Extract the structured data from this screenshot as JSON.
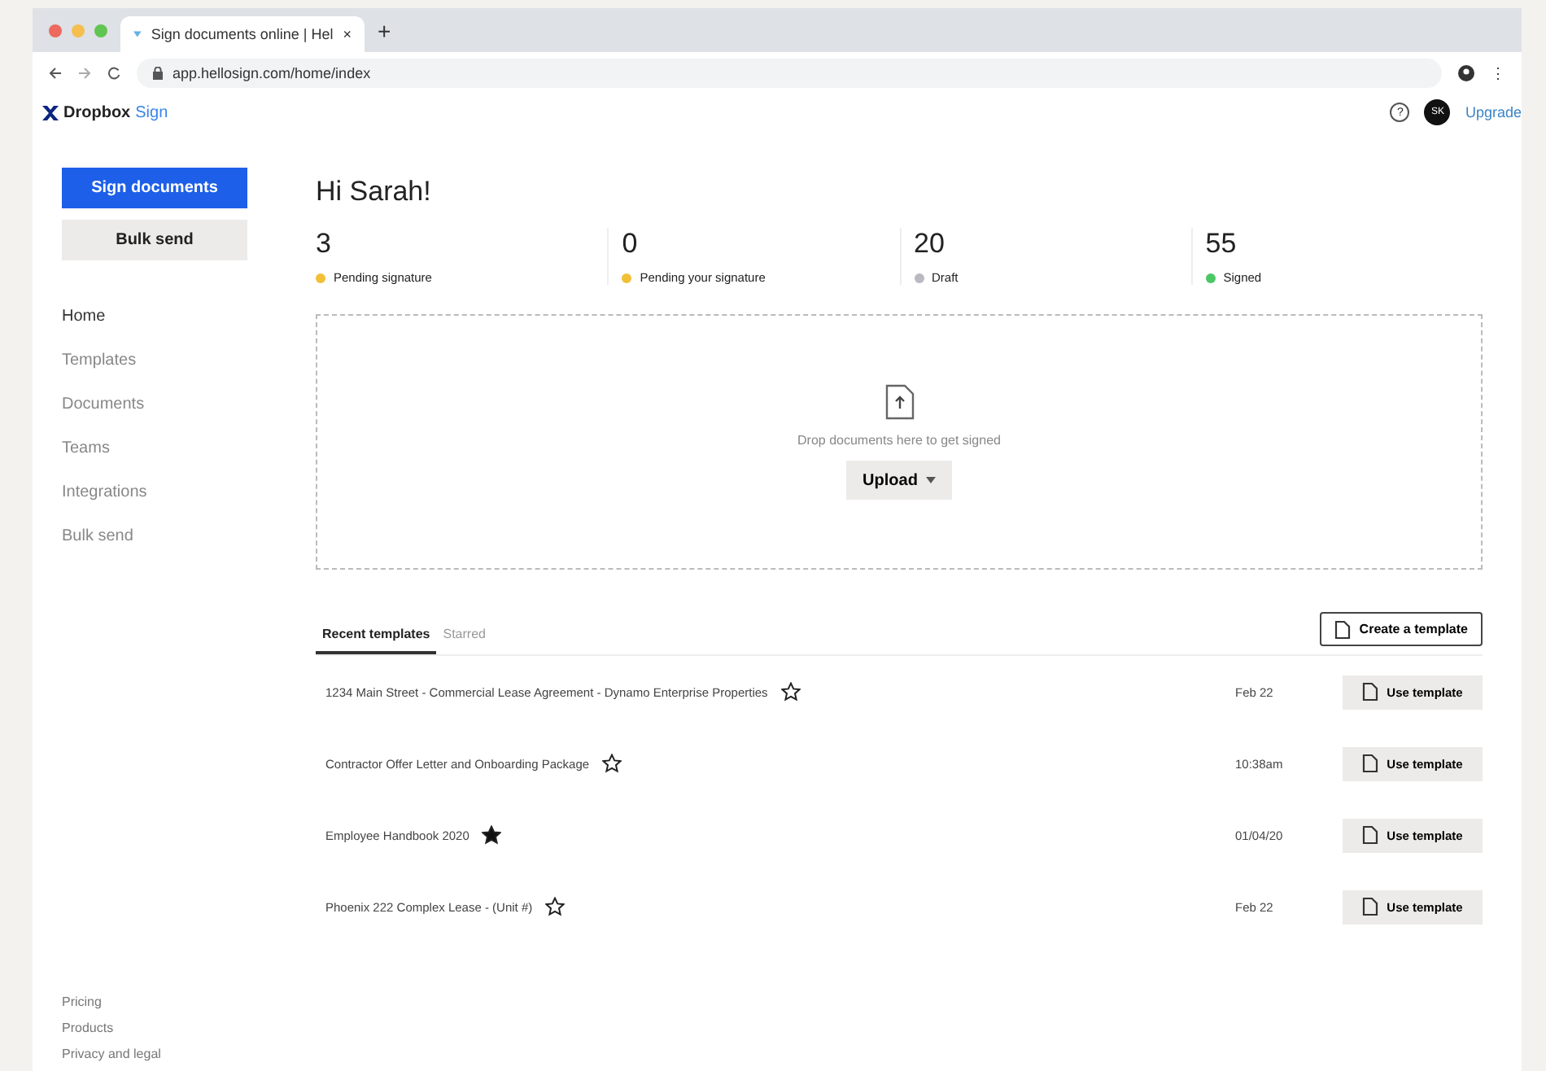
{
  "browser": {
    "tab_title": "Sign documents online | Hel",
    "tab_close": "×",
    "new_tab": "+",
    "url": "app.hellosign.com/home/index",
    "menu": "⋮"
  },
  "header": {
    "logo_brand": "Dropbox",
    "logo_product": "Sign",
    "help": "?",
    "avatar": "SK",
    "upgrade": "Upgrade"
  },
  "sidebar": {
    "primary_button": "Sign documents",
    "secondary_button": "Bulk send",
    "items": [
      {
        "label": "Home",
        "selected": true
      },
      {
        "label": "Templates",
        "selected": false
      },
      {
        "label": "Documents",
        "selected": false
      },
      {
        "label": "Teams",
        "selected": false
      },
      {
        "label": "Integrations",
        "selected": false
      },
      {
        "label": "Bulk send",
        "selected": false
      }
    ],
    "footer_links": [
      "Pricing",
      "Products",
      "Privacy and legal"
    ]
  },
  "greeting": "Hi Sarah!",
  "stats": [
    {
      "count": "3",
      "label": "Pending signature",
      "color": "#f2c037"
    },
    {
      "count": "0",
      "label": "Pending your signature",
      "color": "#f2c037"
    },
    {
      "count": "20",
      "label": "Draft",
      "color": "#b9b9c1"
    },
    {
      "count": "55",
      "label": "Signed",
      "color": "#4cc764"
    }
  ],
  "dropzone": {
    "text": "Drop documents here to get signed",
    "button": "Upload"
  },
  "tabs": [
    {
      "label": "Recent templates",
      "selected": true
    },
    {
      "label": "Starred",
      "selected": false
    }
  ],
  "create_button": "Create a template",
  "templates": [
    {
      "name": "1234 Main Street - Commercial Lease Agreement - Dynamo Enterprise Properties",
      "starred": false,
      "date": "Feb 22",
      "action": "Use template"
    },
    {
      "name": "Contractor Offer Letter and Onboarding Package",
      "starred": false,
      "date": "10:38am",
      "action": "Use template"
    },
    {
      "name": "Employee Handbook 2020",
      "starred": true,
      "date": "01/04/20",
      "action": "Use template"
    },
    {
      "name": "Phoenix 222 Complex Lease - (Unit #)",
      "starred": false,
      "date": "Feb 22",
      "action": "Use template"
    }
  ]
}
